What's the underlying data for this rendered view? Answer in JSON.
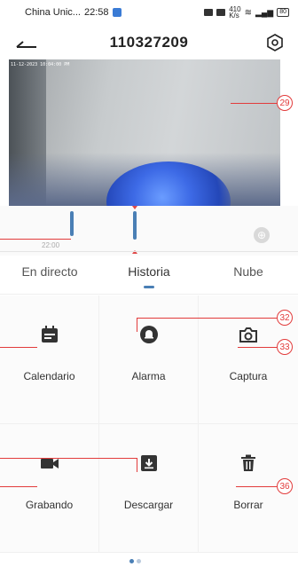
{
  "status_bar": {
    "carrier": "China Unic...",
    "time": "22:58",
    "speed_value": "410",
    "speed_unit": "K/s",
    "battery": "80"
  },
  "header": {
    "title": "110327209"
  },
  "video": {
    "timestamp": "11-12-2023 10:04:00 PM"
  },
  "timeline": {
    "time_label": "22:00"
  },
  "tabs": [
    {
      "label": "En directo",
      "active": false
    },
    {
      "label": "Historia",
      "active": true
    },
    {
      "label": "Nube",
      "active": false
    }
  ],
  "actions": [
    {
      "label": "Calendario",
      "icon": "calendar-icon"
    },
    {
      "label": "Alarma",
      "icon": "bell-icon"
    },
    {
      "label": "Captura",
      "icon": "camera-icon"
    },
    {
      "label": "Grabando",
      "icon": "video-camera-icon"
    },
    {
      "label": "Descargar",
      "icon": "download-icon"
    },
    {
      "label": "Borrar",
      "icon": "trash-icon"
    }
  ],
  "annotations": {
    "c29": "29",
    "c32": "32",
    "c33": "33",
    "c36": "36"
  },
  "colors": {
    "accent": "#4a7fb5",
    "annotation": "#e23b3b"
  }
}
